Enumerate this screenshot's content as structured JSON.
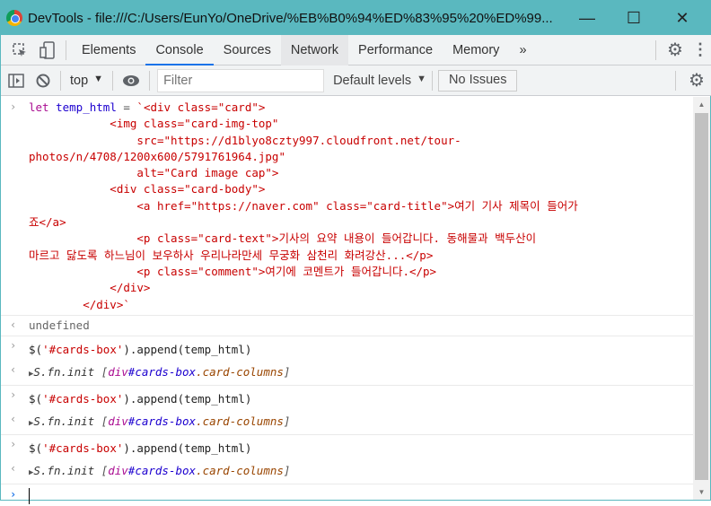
{
  "window": {
    "title": "DevTools - file:///C:/Users/EunYo/OneDrive/%EB%B0%94%ED%83%95%20%ED%99...",
    "minimize": "—",
    "maximize": "☐",
    "close": "✕"
  },
  "tabs": [
    {
      "label": "Elements"
    },
    {
      "label": "Console"
    },
    {
      "label": "Sources"
    },
    {
      "label": "Network"
    },
    {
      "label": "Performance"
    },
    {
      "label": "Memory"
    }
  ],
  "tabs_more": "»",
  "toolbar": {
    "context": "top",
    "filter_placeholder": "Filter",
    "levels": "Default levels",
    "issues": "No Issues"
  },
  "console": {
    "first_input": {
      "kw": "let",
      "var": "temp_html",
      "op": " = ",
      "rest": "`<div class=\"card\">"
    },
    "code_lines": [
      "            <img class=\"card-img-top\"",
      "                src=\"https://d1blyo8czty997.cloudfront.net/tour-",
      "photos/n/4708/1200x600/5791761964.jpg\"",
      "                alt=\"Card image cap\">",
      "            <div class=\"card-body\">",
      "                <a href=\"https://naver.com\" class=\"card-title\">여기 기사 제목이 들어가",
      "죠</a>",
      "                <p class=\"card-text\">기사의 요약 내용이 들어갑니다. 동해물과 백두산이",
      "마르고 닳도록 하느님이 보우하사 우리나라만세 무궁화 삼천리 화려강산...</p>",
      "                <p class=\"comment\">여기에 코멘트가 들어갑니다.</p>",
      "            </div>",
      "        </div>`"
    ],
    "first_result": "undefined",
    "commands": [
      {
        "pre": "$(",
        "str": "'#cards-box'",
        "post": ").append(temp_html)",
        "res_fn": "S.fn.init ",
        "res_tag": "div",
        "res_id": "#cards-box",
        "res_cls": ".card-columns"
      },
      {
        "pre": "$(",
        "str": "'#cards-box'",
        "post": ").append(temp_html)",
        "res_fn": "S.fn.init ",
        "res_tag": "div",
        "res_id": "#cards-box",
        "res_cls": ".card-columns"
      },
      {
        "pre": "$(",
        "str": "'#cards-box'",
        "post": ").append(temp_html)",
        "res_fn": "S.fn.init ",
        "res_tag": "div",
        "res_id": "#cards-box",
        "res_cls": ".card-columns"
      }
    ]
  }
}
